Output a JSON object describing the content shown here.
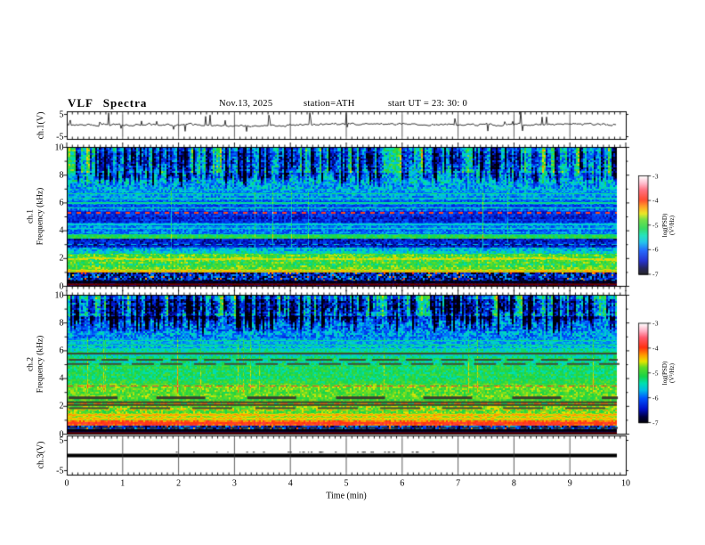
{
  "header": {
    "title": "VLF Spectra",
    "date": "Nov.13, 2025",
    "station": "station=ATH",
    "start_ut": "start UT =  23: 30: 0"
  },
  "axes": {
    "x": {
      "label": "Time (min)",
      "ticks": [
        0,
        1,
        2,
        3,
        4,
        5,
        6,
        7,
        8,
        9,
        10
      ],
      "minor_step": 0.1,
      "range_min": [
        0,
        10
      ]
    },
    "panel1": {
      "ylabel": "ch.1(V)",
      "yticks": [
        5,
        -5
      ]
    },
    "spec1": {
      "channel": "ch.1",
      "ylabel": "Frequency (kHz)",
      "yticks": [
        10,
        8,
        6,
        4,
        2,
        0
      ],
      "range_khz": [
        0,
        10
      ]
    },
    "spec2": {
      "channel": "ch.2",
      "ylabel": "Frequency (kHz)",
      "yticks": [
        10,
        8,
        6,
        4,
        2,
        0
      ],
      "range_khz": [
        0,
        10
      ]
    },
    "panel4": {
      "ylabel": "ch.3(V)",
      "yticks": [
        5,
        -5
      ]
    }
  },
  "colorbar": {
    "label": "log(PSD)(V²/Hz)",
    "ticks": [
      -3,
      -4,
      -5,
      -6,
      -7
    ],
    "range": [
      -3,
      -7
    ],
    "gradient_stops": [
      [
        0.0,
        "#000008"
      ],
      [
        0.06,
        "#00003c"
      ],
      [
        0.14,
        "#0010c8"
      ],
      [
        0.25,
        "#0055ff"
      ],
      [
        0.33,
        "#00bce8"
      ],
      [
        0.4,
        "#00e0b0"
      ],
      [
        0.47,
        "#18d448"
      ],
      [
        0.56,
        "#60dc28"
      ],
      [
        0.62,
        "#e8e400"
      ],
      [
        0.68,
        "#ffa000"
      ],
      [
        0.76,
        "#ff3010"
      ],
      [
        0.86,
        "#ff5a6e"
      ],
      [
        0.93,
        "#ffb4c8"
      ],
      [
        1.0,
        "#ffffff"
      ]
    ]
  },
  "chart_data": {
    "type": "multi-panel",
    "title": "VLF Spectra",
    "panels": [
      {
        "type": "line",
        "channel": "ch.1",
        "units": "V",
        "x_range_min": [
          0,
          9.8
        ],
        "y_range": [
          -5,
          5
        ],
        "mean_v": 0.4,
        "noise_v": 0.8,
        "spike_count": 26,
        "spike_max_v": 4.8,
        "color": "#000000",
        "seed": 7
      },
      {
        "type": "heatmap",
        "channel": "ch.1",
        "z_units": "log(PSD)(V²/Hz)",
        "x_range_min": [
          0,
          9.8
        ],
        "f_range_khz": [
          0,
          10
        ],
        "z_range": [
          -7,
          -3
        ],
        "seed": 11,
        "bands": [
          [
            9.75,
            10,
            -4.95,
            0.3
          ],
          [
            8.2,
            9.75,
            -5.1,
            0.5
          ],
          [
            7.0,
            8.2,
            -5.6,
            0.45
          ],
          [
            6.2,
            7.0,
            -5.8,
            0.3
          ],
          [
            5.45,
            6.2,
            -6.0,
            0.3
          ],
          [
            4.55,
            5.45,
            -6.3,
            0.3
          ],
          [
            3.75,
            4.55,
            -5.9,
            0.3
          ],
          [
            3.45,
            3.75,
            -5.15,
            0.25
          ],
          [
            2.75,
            3.45,
            -6.4,
            0.35
          ],
          [
            2.3,
            2.75,
            -5.55,
            0.35
          ],
          [
            1.25,
            2.3,
            -5.0,
            0.4
          ],
          [
            0.95,
            1.25,
            -4.75,
            0.3
          ],
          [
            0.4,
            0.95,
            -6.4,
            0.8
          ],
          [
            0.18,
            0.4,
            -6.85,
            0.2
          ],
          [
            0.0,
            0.18,
            -6.7,
            0.4
          ]
        ],
        "lines": [
          [
            5.3,
            0.05,
            -3.95,
            5,
            6,
            0
          ],
          [
            6.7,
            0.04,
            -5.3,
            0,
            0,
            0
          ],
          [
            6.35,
            0.04,
            -5.35,
            0,
            0,
            0
          ],
          [
            6.0,
            0.04,
            -5.3,
            0,
            0,
            0
          ],
          [
            5.65,
            0.04,
            -5.35,
            0,
            0,
            0
          ],
          [
            4.45,
            0.04,
            -5.55,
            0,
            0,
            0
          ],
          [
            4.15,
            0.04,
            -5.5,
            0,
            0,
            0
          ],
          [
            3.0,
            0.04,
            -5.6,
            6,
            6,
            0
          ],
          [
            1.95,
            0.08,
            -4.55,
            0,
            0,
            1
          ],
          [
            1.12,
            0.05,
            -4.4,
            0,
            0,
            0
          ],
          [
            0.98,
            0.04,
            -4.3,
            0,
            0,
            0
          ]
        ],
        "overlays": [
          [
            0.1,
            "#700000",
            2,
            0,
            0
          ]
        ],
        "streaks": {
          "f_start": 6.9,
          "f_full": 8.2,
          "depth": 2.1,
          "bright_gain": 0.8,
          "bright_f": [
            2.8,
            6.9
          ]
        }
      },
      {
        "type": "heatmap",
        "channel": "ch.2",
        "z_units": "log(PSD)(V²/Hz)",
        "x_range_min": [
          0,
          9.8
        ],
        "f_range_khz": [
          0,
          10
        ],
        "z_range": [
          -7,
          -3
        ],
        "seed": 29,
        "bands": [
          [
            9.75,
            10,
            -4.95,
            0.35
          ],
          [
            8.5,
            9.75,
            -5.3,
            0.55
          ],
          [
            7.0,
            8.5,
            -5.85,
            0.45
          ],
          [
            6.2,
            7.0,
            -5.75,
            0.3
          ],
          [
            5.6,
            6.2,
            -5.45,
            0.3
          ],
          [
            4.9,
            5.6,
            -5.25,
            0.3
          ],
          [
            3.6,
            4.9,
            -5.1,
            0.3
          ],
          [
            2.35,
            3.6,
            -4.9,
            0.3
          ],
          [
            2.05,
            2.35,
            -5.05,
            0.4
          ],
          [
            1.5,
            2.05,
            -4.75,
            0.35
          ],
          [
            0.95,
            1.5,
            -4.6,
            0.3
          ],
          [
            0.55,
            0.95,
            -4.1,
            0.25
          ],
          [
            0.3,
            0.55,
            -6.2,
            0.7
          ],
          [
            0.05,
            0.3,
            -6.95,
            0.05
          ],
          [
            0.0,
            0.05,
            -6.6,
            0.3
          ]
        ],
        "lines": [
          [
            3.45,
            0.06,
            -3.85,
            7,
            5,
            0
          ],
          [
            2.2,
            0.05,
            -4.2,
            8,
            7,
            0
          ],
          [
            1.7,
            0.05,
            -4.3,
            6,
            8,
            0
          ],
          [
            1.35,
            0.04,
            -4.35,
            0,
            0,
            0
          ],
          [
            1.1,
            0.04,
            -4.4,
            0,
            0,
            0
          ],
          [
            0.75,
            0.06,
            -3.9,
            0,
            0,
            0
          ],
          [
            6.75,
            0.04,
            -5.3,
            0,
            0,
            0
          ],
          [
            6.4,
            0.04,
            -5.25,
            0,
            0,
            0
          ],
          [
            5.9,
            0.04,
            -5.2,
            0,
            0,
            0
          ]
        ],
        "overlays": [
          [
            5.8,
            "#3f4630",
            2,
            0,
            0
          ],
          [
            5.35,
            "#3f4630",
            2,
            30,
            8
          ],
          [
            5.05,
            "#444a32",
            2,
            25,
            10
          ],
          [
            2.6,
            "#3a402e",
            3,
            55,
            45
          ],
          [
            2.28,
            "#3c422e",
            2,
            0,
            0
          ],
          [
            2.08,
            "#3c422e",
            2,
            0,
            0
          ],
          [
            1.85,
            "#474d33",
            2,
            45,
            25
          ],
          [
            0.42,
            "#303030",
            2,
            8,
            5
          ],
          [
            0.03,
            "#700000",
            2,
            0,
            0
          ]
        ],
        "streaks": {
          "f_start": 7.0,
          "f_full": 8.5,
          "depth": 2.1,
          "bright_gain": 0.75,
          "bright_f": [
            3.0,
            7.0
          ]
        }
      },
      {
        "type": "line",
        "channel": "ch.3",
        "units": "V",
        "x_range_min": [
          0,
          9.8
        ],
        "y_range": [
          -5,
          5
        ],
        "value_v": 0,
        "line_thickness_v": 0.9,
        "color": "#000000",
        "seed": 3
      }
    ]
  }
}
